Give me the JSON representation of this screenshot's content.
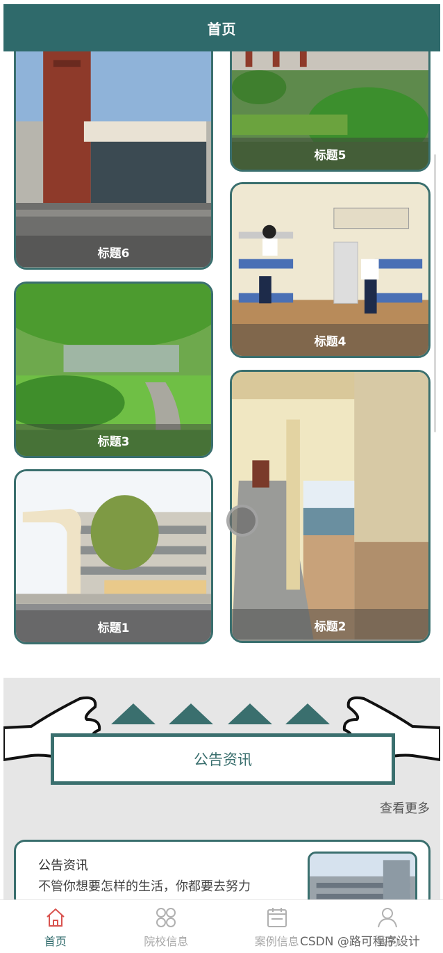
{
  "header": {
    "title": "首页"
  },
  "gallery": {
    "items": [
      {
        "title": "标题6"
      },
      {
        "title": "标题5"
      },
      {
        "title": "标题4"
      },
      {
        "title": "标题3"
      },
      {
        "title": "标题2"
      },
      {
        "title": "标题1"
      }
    ]
  },
  "notice": {
    "banner_label": "公告资讯",
    "more_label": "查看更多",
    "items": [
      {
        "title": "公告资讯",
        "desc": "不管你想要怎样的生活，你都要去努力"
      }
    ]
  },
  "tabbar": {
    "items": [
      {
        "label": "首页",
        "icon": "home-icon",
        "active": true
      },
      {
        "label": "院校信息",
        "icon": "grid-icon",
        "active": false
      },
      {
        "label": "案例信息",
        "icon": "calendar-icon",
        "active": false
      },
      {
        "label": "我的",
        "icon": "user-icon",
        "active": false
      }
    ]
  },
  "watermark": "CSDN @路可程序设计",
  "colors": {
    "brand": "#2f6a6b",
    "active_tab": "#d9534f"
  }
}
